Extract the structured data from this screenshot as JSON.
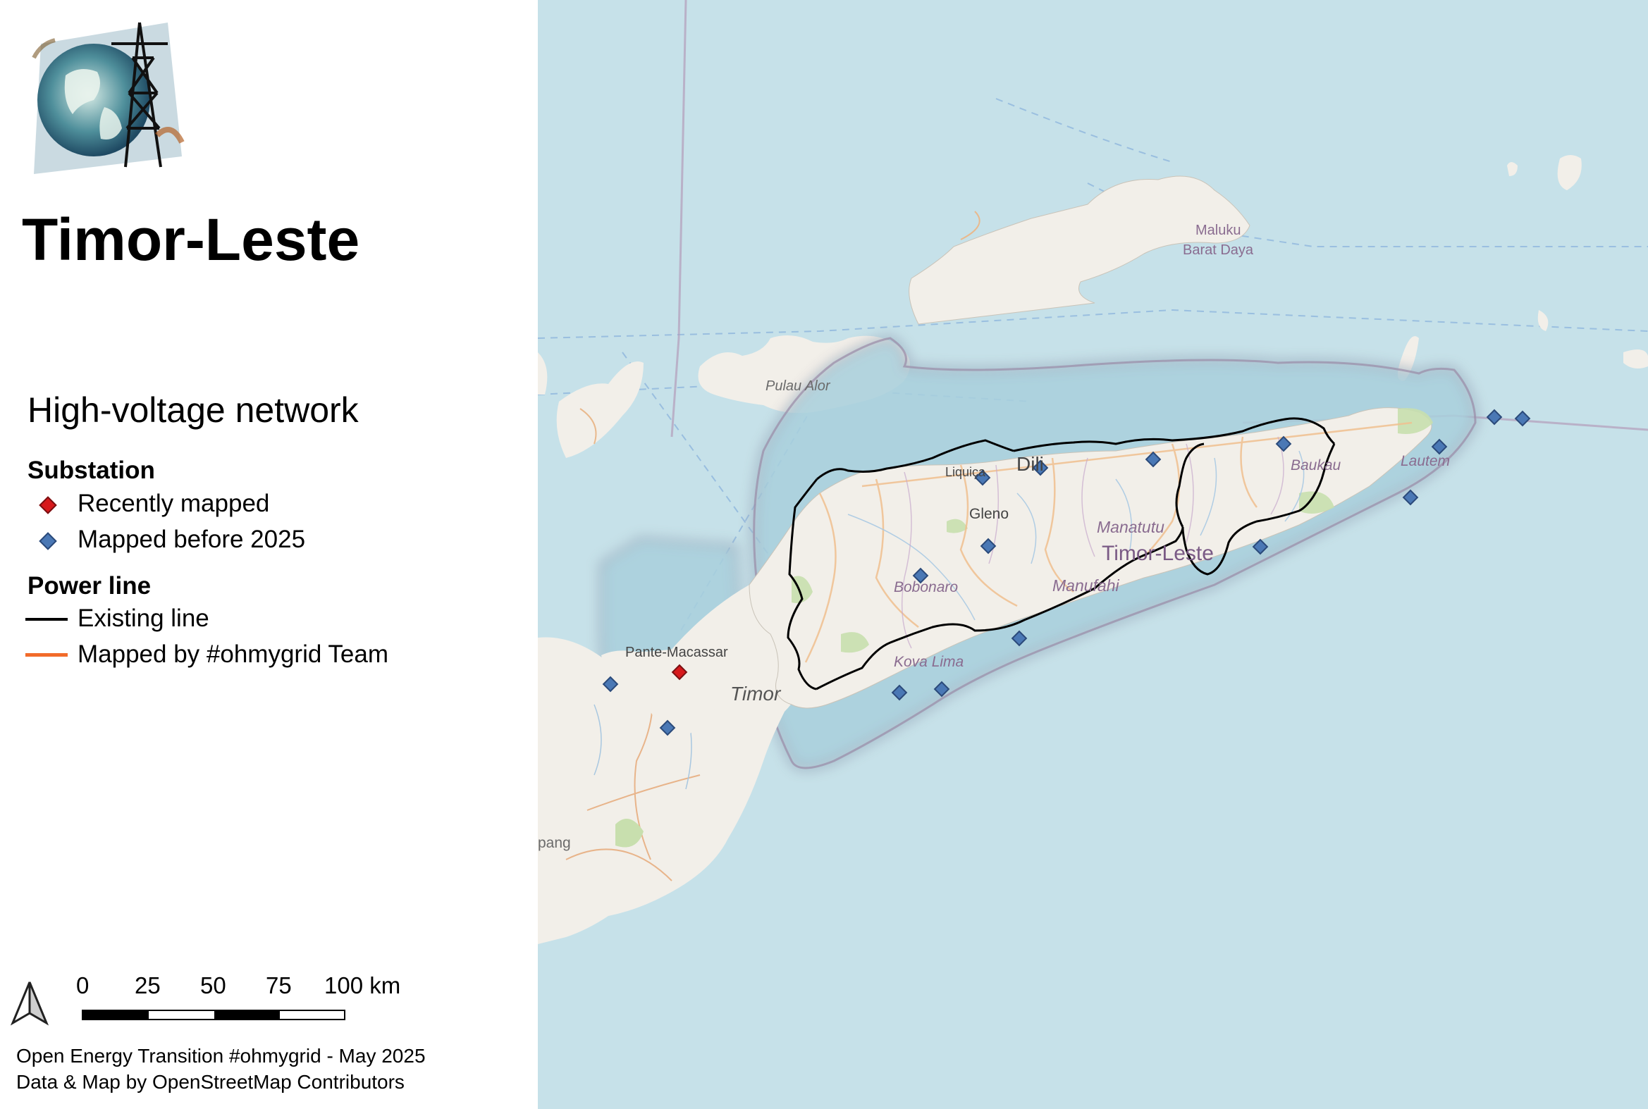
{
  "title": "Timor-Leste",
  "subtitle": "High-voltage network",
  "legend": {
    "substation_heading": "Substation",
    "recent_label": "Recently mapped",
    "before_label": "Mapped before 2025",
    "powerline_heading": "Power line",
    "existing_label": "Existing line",
    "mapped_label": "Mapped by #ohmygrid Team"
  },
  "colors": {
    "recent_substation": "#d7191c",
    "before_substation": "#4a78b5",
    "existing_line": "#000000",
    "mapped_line": "#f26b2a",
    "sea": "#c6e1e9",
    "land": "#f2efe9"
  },
  "scale": {
    "ticks": [
      "0",
      "25",
      "50",
      "75",
      "100 km"
    ]
  },
  "north_arrow_icon": "north-arrow-icon",
  "logo_icon": "globe-transmission-tower-logo",
  "credits": {
    "line1": "Open Energy Transition #ohmygrid - May 2025",
    "line2": "Data & Map by OpenStreetMap Contributors"
  },
  "map_labels": {
    "maluku": "Maluku",
    "barat_daya": "Barat Daya",
    "pulau_alor": "Pulau Alor",
    "dili": "Dili",
    "liquica": "Liquiça",
    "gleno": "Gleno",
    "manatutu": "Manatutu",
    "timor_leste": "Timor-Leste",
    "manufahi": "Manufahi",
    "bobonaro": "Bobonaro",
    "kova_lima": "Kova Lima",
    "baukau": "Baukau",
    "lautem": "Lautem",
    "pante_macassar": "Pante-Macassar",
    "timor": "Timor",
    "kupang": "pang"
  }
}
